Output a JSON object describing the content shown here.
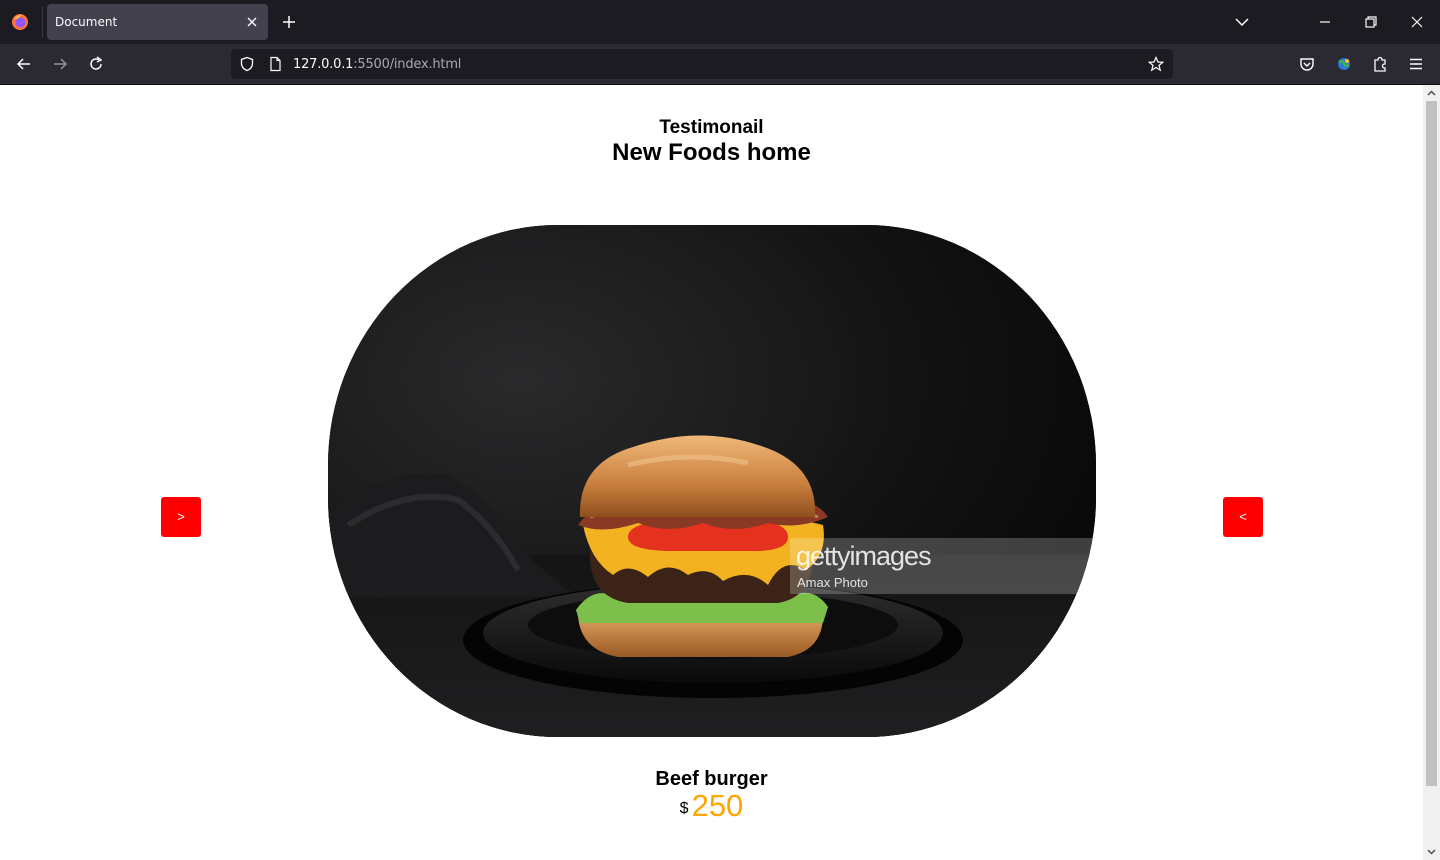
{
  "browser": {
    "tab_title": "Document",
    "url_host": "127.0.0.1",
    "url_rest": ":5500/index.html"
  },
  "page": {
    "subtitle": "Testimonail",
    "title": "New Foods home",
    "prev_label": ">",
    "next_label": "<",
    "item_name": "Beef burger",
    "currency": "$",
    "price": "250",
    "watermark_brand": "gettyimages",
    "watermark_credit": "Amax Photo"
  },
  "colors": {
    "button": "#ff0000",
    "price": "#ffa500"
  }
}
